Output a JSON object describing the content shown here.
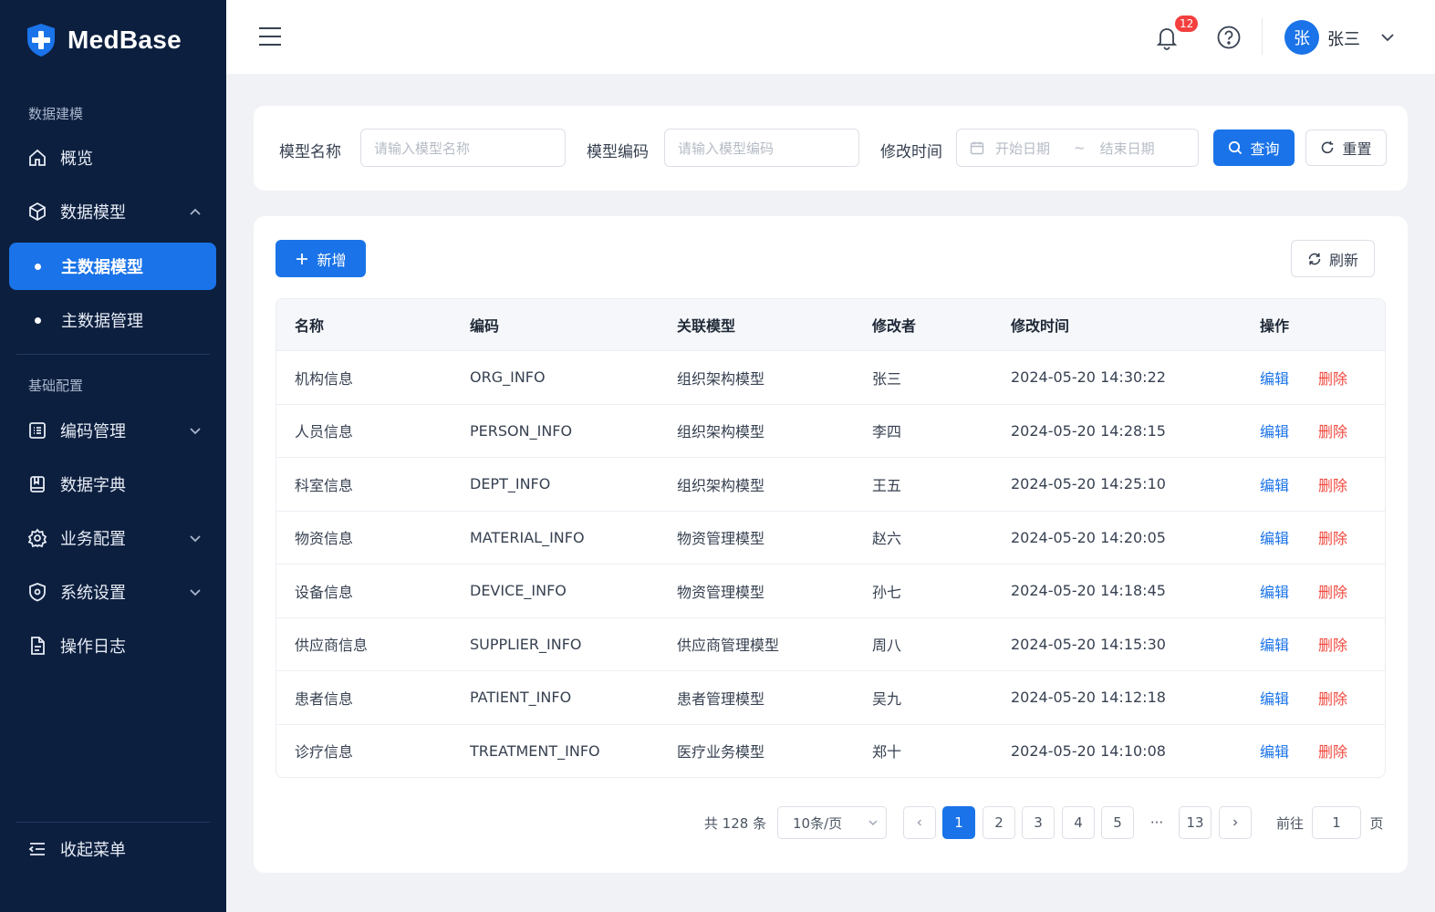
{
  "app": {
    "name": "MedBase"
  },
  "sidebar": {
    "section_modeling": "数据建模",
    "section_basic": "基础配置",
    "items": {
      "overview": "概览",
      "data_model": "数据模型",
      "master_model": "主数据模型",
      "master_manage": "主数据管理",
      "code_manage": "编码管理",
      "data_dict": "数据字典",
      "business_config": "业务配置",
      "system_settings": "系统设置",
      "operation_log": "操作日志"
    },
    "collapse": "收起菜单",
    "active_color": "#1a73e8"
  },
  "header": {
    "notification_count": "12",
    "user_avatar": "张",
    "user_name": "张三"
  },
  "filter": {
    "model_name_label": "模型名称",
    "model_name_placeholder": "请输入模型名称",
    "model_code_label": "模型编码",
    "model_code_placeholder": "请输入模型编码",
    "modified_time_label": "修改时间",
    "start_date_placeholder": "开始日期",
    "range_separator": "~",
    "end_date_placeholder": "结束日期",
    "query_button": "查询",
    "reset_button": "重置"
  },
  "toolbar": {
    "add_button": "新增",
    "refresh_button": "刷新"
  },
  "table": {
    "columns": [
      "名称",
      "编码",
      "关联模型",
      "修改者",
      "修改时间",
      "操作"
    ],
    "edit_label": "编辑",
    "delete_label": "删除",
    "rows": [
      [
        "机构信息",
        "ORG_INFO",
        "组织架构模型",
        "张三",
        "2024-05-20 14:30:22"
      ],
      [
        "人员信息",
        "PERSON_INFO",
        "组织架构模型",
        "李四",
        "2024-05-20 14:28:15"
      ],
      [
        "科室信息",
        "DEPT_INFO",
        "组织架构模型",
        "王五",
        "2024-05-20 14:25:10"
      ],
      [
        "物资信息",
        "MATERIAL_INFO",
        "物资管理模型",
        "赵六",
        "2024-05-20 14:20:05"
      ],
      [
        "设备信息",
        "DEVICE_INFO",
        "物资管理模型",
        "孙七",
        "2024-05-20 14:18:45"
      ],
      [
        "供应商信息",
        "SUPPLIER_INFO",
        "供应商管理模型",
        "周八",
        "2024-05-20 14:15:30"
      ],
      [
        "患者信息",
        "PATIENT_INFO",
        "患者管理模型",
        "吴九",
        "2024-05-20 14:12:18"
      ],
      [
        "诊疗信息",
        "TREATMENT_INFO",
        "医疗业务模型",
        "郑十",
        "2024-05-20 14:10:08"
      ]
    ]
  },
  "pagination": {
    "total": "共 128 条",
    "page_size": "10条/页",
    "pages": [
      "1",
      "2",
      "3",
      "4",
      "5"
    ],
    "ellipsis": "···",
    "last_page": "13",
    "current": "1",
    "goto_label": "前往",
    "goto_value": "1",
    "goto_suffix": "页"
  }
}
